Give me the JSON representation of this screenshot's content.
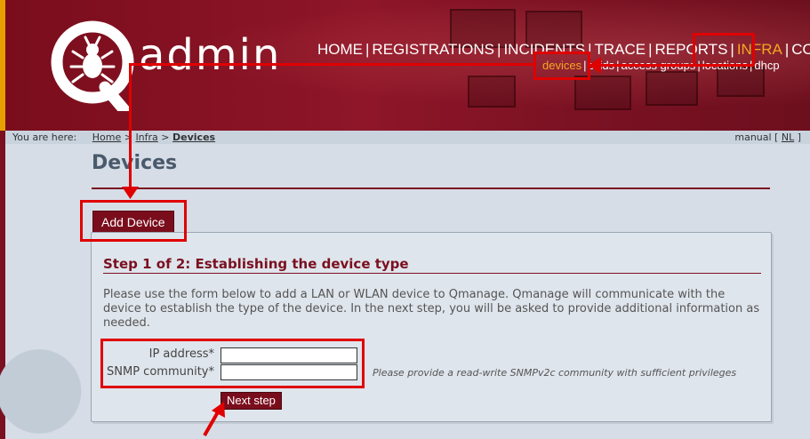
{
  "brand": {
    "logo_text": "admin",
    "logo_letter": "Q"
  },
  "main_nav": [
    {
      "label": "HOME",
      "active": false
    },
    {
      "label": "REGISTRATIONS",
      "active": false
    },
    {
      "label": "INCIDENTS",
      "active": false
    },
    {
      "label": "TRACE",
      "active": false
    },
    {
      "label": "REPORTS",
      "active": false
    },
    {
      "label": "INFRA",
      "active": true
    },
    {
      "label": "CONFIG",
      "active": false
    }
  ],
  "sub_nav": [
    {
      "label": "devices",
      "active": true
    },
    {
      "label": "ssids",
      "active": false
    },
    {
      "label": "access groups",
      "active": false
    },
    {
      "label": "locations",
      "active": false
    },
    {
      "label": "dhcp",
      "active": false
    }
  ],
  "breadcrumb": {
    "prefix": "You are here:",
    "home": "Home",
    "sep1": ">",
    "infra": "Infra",
    "sep2": ">",
    "current": "Devices",
    "manual": "manual [",
    "lang": "NL",
    "manual_close": "]"
  },
  "page": {
    "title": "Devices"
  },
  "tab": {
    "add_device": "Add Device"
  },
  "form": {
    "step_title": "Step 1 of 2: Establishing the device type",
    "intro": "Please use the form below to add a LAN or WLAN device to Qmanage. Qmanage will communicate with the device to establish the type of the device. In the next step, you will be asked to provide additional information as needed.",
    "ip_label": "IP address*",
    "ip_value": "",
    "snmp_label": "SNMP community*",
    "snmp_value": "",
    "snmp_hint": "Please provide a read-write SNMPv2c community with sufficient privileges",
    "next_button": "Next step"
  },
  "colors": {
    "brand": "#7a0d1c",
    "accent": "#f5a623",
    "annotation": "#e00000"
  }
}
